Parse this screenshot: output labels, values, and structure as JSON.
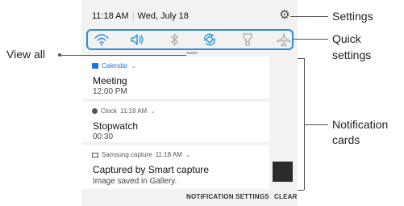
{
  "status_bar": {
    "time": "11:18 AM",
    "date": "Wed, July 18"
  },
  "quick_settings": {
    "icons": [
      "wifi-icon",
      "sound-icon",
      "bluetooth-icon",
      "auto-rotate-icon",
      "flashlight-icon",
      "airplane-mode-icon"
    ]
  },
  "notifications": [
    {
      "app": "Calendar",
      "title": "Meeting",
      "text": "12:00 PM",
      "app_color": "#1a73e8",
      "app_icon": "calendar-icon"
    },
    {
      "app": "Clock",
      "time": "11:18 AM",
      "title": "Stopwatch",
      "text": "00:30",
      "app_icon": "clock-icon"
    },
    {
      "app": "Samsung capture",
      "time": "11:18 AM",
      "title": "Captured by Smart capture",
      "text": "Image saved in Gallery.",
      "app_icon": "image-icon"
    }
  ],
  "footer": {
    "settings_label": "NOTIFICATION SETTINGS",
    "clear_label": "CLEAR"
  },
  "callouts": {
    "settings": "Settings",
    "quick_settings_line1": "Quick",
    "quick_settings_line2": "settings",
    "view_all": "View all",
    "cards_line1": "Notification",
    "cards_line2": "cards"
  },
  "colors": {
    "accent": "#2b8fd8",
    "panel_bg": "#f2f2f2"
  }
}
